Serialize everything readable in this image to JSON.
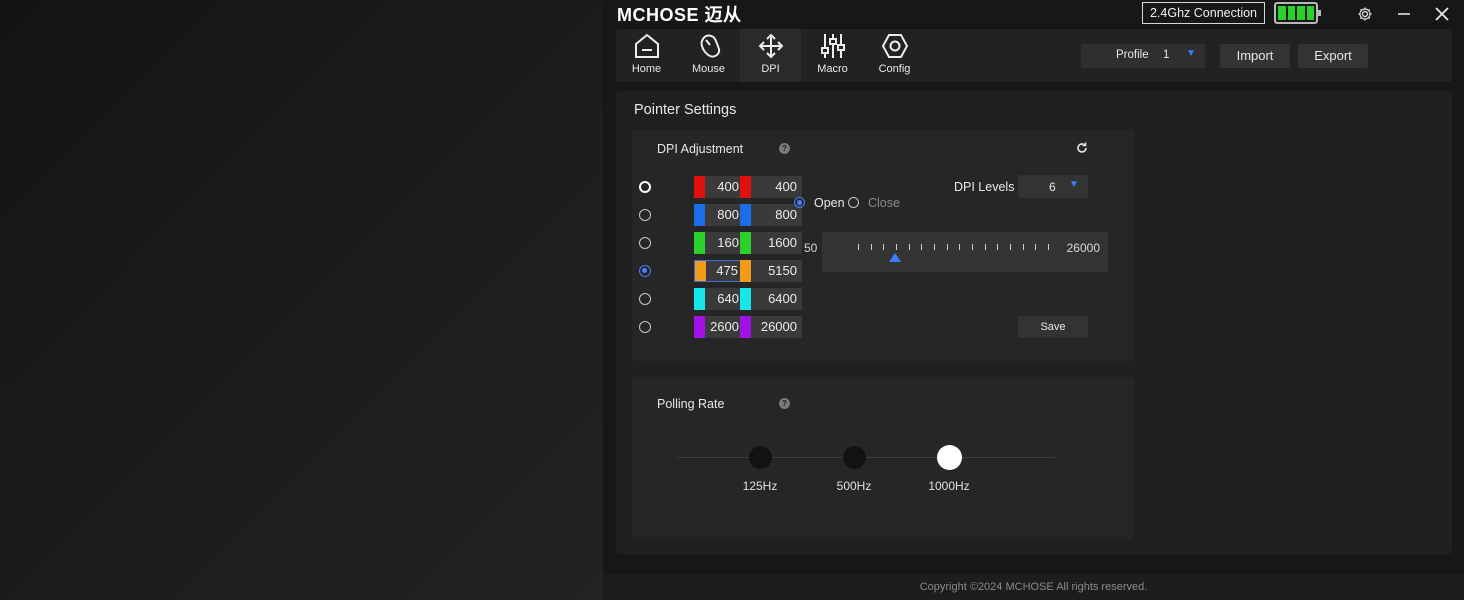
{
  "titlebar": {
    "brand": "MCHOSE 迈从",
    "connection": "2.4Ghz Connection",
    "battery_level": 1.0,
    "battery_color": "#2bd12b",
    "icons": [
      "settings-icon",
      "minimize-icon",
      "close-icon"
    ]
  },
  "nav": {
    "items": [
      {
        "label": "Home",
        "icon": "home-icon"
      },
      {
        "label": "Mouse",
        "icon": "mouse-icon"
      },
      {
        "label": "DPI",
        "icon": "move-arrows-icon"
      },
      {
        "label": "Macro",
        "icon": "sliders-icon"
      },
      {
        "label": "Config",
        "icon": "hexagon-nut-icon"
      }
    ],
    "active": "DPI"
  },
  "profile": {
    "label": "Profile",
    "value": "1"
  },
  "actions": {
    "import": "Import",
    "export": "Export"
  },
  "pointer": {
    "title": "Pointer Settings",
    "dpi_title": "DPI Adjustment",
    "help": "?",
    "levels": [
      {
        "color": "#e01010",
        "x": "400",
        "y": "400"
      },
      {
        "color": "#1a6fe8",
        "x": "800",
        "y": "800"
      },
      {
        "color": "#2ad12a",
        "x": "160",
        "y": "1600"
      },
      {
        "color": "#f29a1a",
        "x": "475",
        "y": "5150"
      },
      {
        "color": "#17e6ea",
        "x": "640",
        "y": "6400"
      },
      {
        "color": "#a012e6",
        "x": "2600",
        "y": "26000"
      }
    ],
    "selected_level": 4,
    "xy_open": "Open",
    "xy_close": "Close",
    "xy_mode": "Open",
    "dpi_levels_label": "DPI Levels",
    "dpi_levels_value": "6",
    "slider_min": "50",
    "slider_max": "26000",
    "slider_value": 5150,
    "save": "Save"
  },
  "polling": {
    "title": "Polling Rate",
    "help": "?",
    "options": [
      "125Hz",
      "500Hz",
      "1000Hz"
    ],
    "selected": "1000Hz"
  },
  "footer": {
    "copyright": "Copyright ©2024 MCHOSE All rights reserved."
  }
}
